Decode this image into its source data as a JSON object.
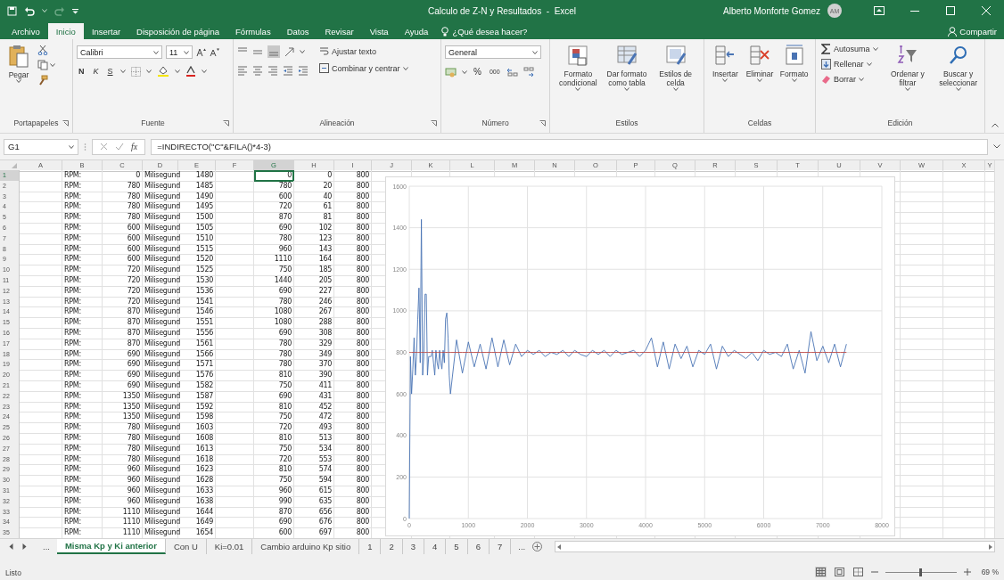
{
  "title_bar": {
    "title": "Calculo de Z-N y Resultados  -  Excel",
    "user": "Alberto Monforte Gomez",
    "initials": "AM"
  },
  "menu": {
    "tabs": [
      {
        "label": "Archivo",
        "selected": false
      },
      {
        "label": "Inicio",
        "selected": true
      },
      {
        "label": "Insertar",
        "selected": false
      },
      {
        "label": "Disposición de página",
        "selected": false
      },
      {
        "label": "Fórmulas",
        "selected": false
      },
      {
        "label": "Datos",
        "selected": false
      },
      {
        "label": "Revisar",
        "selected": false
      },
      {
        "label": "Vista",
        "selected": false
      },
      {
        "label": "Ayuda",
        "selected": false
      }
    ],
    "tell_me": "¿Qué desea hacer?",
    "share": "Compartir"
  },
  "ribbon": {
    "groups": [
      {
        "kind": "clipboard",
        "title": "Portapapeles",
        "paste": "Pegar"
      },
      {
        "kind": "font",
        "title": "Fuente",
        "font": "Calibri",
        "size": "11",
        "bold": "N",
        "italic": "K",
        "underline": "S"
      },
      {
        "kind": "alignment",
        "title": "Alineación",
        "wrap": "Ajustar texto",
        "merge": "Combinar y centrar"
      },
      {
        "kind": "number",
        "title": "Número",
        "format": "General",
        "percent": "%",
        "thousands": "000"
      },
      {
        "kind": "styles",
        "title": "Estilos",
        "buttons": [
          "Formato condicional",
          "Dar formato como tabla",
          "Estilos de celda"
        ]
      },
      {
        "kind": "cells",
        "title": "Celdas",
        "buttons": [
          "Insertar",
          "Eliminar",
          "Formato"
        ]
      },
      {
        "kind": "editing",
        "title": "Edición",
        "small": [
          "Autosuma",
          "Rellenar",
          "Borrar"
        ],
        "buttons": [
          "Ordenar y filtrar",
          "Buscar y seleccionar"
        ]
      }
    ]
  },
  "formula_bar": {
    "name_box": "G1",
    "fx": "fx",
    "formula": "=INDIRECTO(\"C\"&FILA()*4-3)"
  },
  "sheet": {
    "columns": [
      {
        "label": "A",
        "selected": false
      },
      {
        "label": "B",
        "selected": false
      },
      {
        "label": "C",
        "selected": false
      },
      {
        "label": "D",
        "selected": false
      },
      {
        "label": "E",
        "selected": false
      },
      {
        "label": "F",
        "selected": false
      },
      {
        "label": "G",
        "selected": true
      },
      {
        "label": "H",
        "selected": false
      },
      {
        "label": "I",
        "selected": false
      },
      {
        "label": "J",
        "selected": false
      },
      {
        "label": "K",
        "selected": false
      },
      {
        "label": "L",
        "selected": false
      },
      {
        "label": "M",
        "selected": false
      },
      {
        "label": "N",
        "selected": false
      },
      {
        "label": "O",
        "selected": false
      },
      {
        "label": "P",
        "selected": false
      },
      {
        "label": "Q",
        "selected": false
      },
      {
        "label": "R",
        "selected": false
      },
      {
        "label": "S",
        "selected": false
      },
      {
        "label": "T",
        "selected": false
      },
      {
        "label": "U",
        "selected": false
      },
      {
        "label": "V",
        "selected": false
      },
      {
        "label": "W",
        "selected": false
      },
      {
        "label": "X",
        "selected": false
      },
      {
        "label": "Y",
        "selected": false
      }
    ],
    "rows": [
      {
        "n": "1",
        "selected": true,
        "b": "RPM:",
        "c": "0",
        "d": "Milisegund",
        "e": "1480",
        "g": "0",
        "h": "0",
        "i": "800"
      },
      {
        "n": "2",
        "selected": false,
        "b": "RPM:",
        "c": "780",
        "d": "Milisegund",
        "e": "1485",
        "g": "780",
        "h": "20",
        "i": "800"
      },
      {
        "n": "3",
        "selected": false,
        "b": "RPM:",
        "c": "780",
        "d": "Milisegund",
        "e": "1490",
        "g": "600",
        "h": "40",
        "i": "800"
      },
      {
        "n": "4",
        "selected": false,
        "b": "RPM:",
        "c": "780",
        "d": "Milisegund",
        "e": "1495",
        "g": "720",
        "h": "61",
        "i": "800"
      },
      {
        "n": "5",
        "selected": false,
        "b": "RPM:",
        "c": "780",
        "d": "Milisegund",
        "e": "1500",
        "g": "870",
        "h": "81",
        "i": "800"
      },
      {
        "n": "6",
        "selected": false,
        "b": "RPM:",
        "c": "600",
        "d": "Milisegund",
        "e": "1505",
        "g": "690",
        "h": "102",
        "i": "800"
      },
      {
        "n": "7",
        "selected": false,
        "b": "RPM:",
        "c": "600",
        "d": "Milisegund",
        "e": "1510",
        "g": "780",
        "h": "123",
        "i": "800"
      },
      {
        "n": "8",
        "selected": false,
        "b": "RPM:",
        "c": "600",
        "d": "Milisegund",
        "e": "1515",
        "g": "960",
        "h": "143",
        "i": "800"
      },
      {
        "n": "9",
        "selected": false,
        "b": "RPM:",
        "c": "600",
        "d": "Milisegund",
        "e": "1520",
        "g": "1110",
        "h": "164",
        "i": "800"
      },
      {
        "n": "10",
        "selected": false,
        "b": "RPM:",
        "c": "720",
        "d": "Milisegund",
        "e": "1525",
        "g": "750",
        "h": "185",
        "i": "800"
      },
      {
        "n": "11",
        "selected": false,
        "b": "RPM:",
        "c": "720",
        "d": "Milisegund",
        "e": "1530",
        "g": "1440",
        "h": "205",
        "i": "800"
      },
      {
        "n": "12",
        "selected": false,
        "b": "RPM:",
        "c": "720",
        "d": "Milisegund",
        "e": "1536",
        "g": "690",
        "h": "227",
        "i": "800"
      },
      {
        "n": "13",
        "selected": false,
        "b": "RPM:",
        "c": "720",
        "d": "Milisegund",
        "e": "1541",
        "g": "780",
        "h": "246",
        "i": "800"
      },
      {
        "n": "14",
        "selected": false,
        "b": "RPM:",
        "c": "870",
        "d": "Milisegund",
        "e": "1546",
        "g": "1080",
        "h": "267",
        "i": "800"
      },
      {
        "n": "15",
        "selected": false,
        "b": "RPM:",
        "c": "870",
        "d": "Milisegund",
        "e": "1551",
        "g": "1080",
        "h": "288",
        "i": "800"
      },
      {
        "n": "16",
        "selected": false,
        "b": "RPM:",
        "c": "870",
        "d": "Milisegund",
        "e": "1556",
        "g": "690",
        "h": "308",
        "i": "800"
      },
      {
        "n": "17",
        "selected": false,
        "b": "RPM:",
        "c": "870",
        "d": "Milisegund",
        "e": "1561",
        "g": "780",
        "h": "329",
        "i": "800"
      },
      {
        "n": "18",
        "selected": false,
        "b": "RPM:",
        "c": "690",
        "d": "Milisegund",
        "e": "1566",
        "g": "780",
        "h": "349",
        "i": "800"
      },
      {
        "n": "19",
        "selected": false,
        "b": "RPM:",
        "c": "690",
        "d": "Milisegund",
        "e": "1571",
        "g": "780",
        "h": "370",
        "i": "800"
      },
      {
        "n": "20",
        "selected": false,
        "b": "RPM:",
        "c": "690",
        "d": "Milisegund",
        "e": "1576",
        "g": "810",
        "h": "390",
        "i": "800"
      },
      {
        "n": "21",
        "selected": false,
        "b": "RPM:",
        "c": "690",
        "d": "Milisegund",
        "e": "1582",
        "g": "750",
        "h": "411",
        "i": "800"
      },
      {
        "n": "22",
        "selected": false,
        "b": "RPM:",
        "c": "1350",
        "d": "Milisegund",
        "e": "1587",
        "g": "690",
        "h": "431",
        "i": "800"
      },
      {
        "n": "23",
        "selected": false,
        "b": "RPM:",
        "c": "1350",
        "d": "Milisegund",
        "e": "1592",
        "g": "810",
        "h": "452",
        "i": "800"
      },
      {
        "n": "24",
        "selected": false,
        "b": "RPM:",
        "c": "1350",
        "d": "Milisegund",
        "e": "1598",
        "g": "750",
        "h": "472",
        "i": "800"
      },
      {
        "n": "25",
        "selected": false,
        "b": "RPM:",
        "c": "780",
        "d": "Milisegund",
        "e": "1603",
        "g": "720",
        "h": "493",
        "i": "800"
      },
      {
        "n": "26",
        "selected": false,
        "b": "RPM:",
        "c": "780",
        "d": "Milisegund",
        "e": "1608",
        "g": "810",
        "h": "513",
        "i": "800"
      },
      {
        "n": "27",
        "selected": false,
        "b": "RPM:",
        "c": "780",
        "d": "Milisegund",
        "e": "1613",
        "g": "750",
        "h": "534",
        "i": "800"
      },
      {
        "n": "28",
        "selected": false,
        "b": "RPM:",
        "c": "780",
        "d": "Milisegund",
        "e": "1618",
        "g": "720",
        "h": "553",
        "i": "800"
      },
      {
        "n": "29",
        "selected": false,
        "b": "RPM:",
        "c": "960",
        "d": "Milisegund",
        "e": "1623",
        "g": "810",
        "h": "574",
        "i": "800"
      },
      {
        "n": "30",
        "selected": false,
        "b": "RPM:",
        "c": "960",
        "d": "Milisegund",
        "e": "1628",
        "g": "750",
        "h": "594",
        "i": "800"
      },
      {
        "n": "31",
        "selected": false,
        "b": "RPM:",
        "c": "960",
        "d": "Milisegund",
        "e": "1633",
        "g": "960",
        "h": "615",
        "i": "800"
      },
      {
        "n": "32",
        "selected": false,
        "b": "RPM:",
        "c": "960",
        "d": "Milisegund",
        "e": "1638",
        "g": "990",
        "h": "635",
        "i": "800"
      },
      {
        "n": "33",
        "selected": false,
        "b": "RPM:",
        "c": "1110",
        "d": "Milisegund",
        "e": "1644",
        "g": "870",
        "h": "656",
        "i": "800"
      },
      {
        "n": "34",
        "selected": false,
        "b": "RPM:",
        "c": "1110",
        "d": "Milisegund",
        "e": "1649",
        "g": "690",
        "h": "676",
        "i": "800"
      },
      {
        "n": "35",
        "selected": false,
        "b": "RPM:",
        "c": "1110",
        "d": "Milisegund",
        "e": "1654",
        "g": "600",
        "h": "697",
        "i": "800"
      }
    ],
    "chart_data": {
      "type": "line",
      "grid": true,
      "xlim": [
        0,
        8000
      ],
      "ylim": [
        0,
        1600
      ],
      "xticks": [
        0,
        1000,
        2000,
        3000,
        4000,
        5000,
        6000,
        7000,
        8000
      ],
      "yticks": [
        0,
        200,
        400,
        600,
        800,
        1000,
        1200,
        1400,
        1600
      ],
      "x": [
        0,
        20,
        40,
        61,
        81,
        102,
        123,
        143,
        164,
        185,
        205,
        227,
        246,
        267,
        288,
        308,
        329,
        349,
        370,
        390,
        411,
        431,
        452,
        472,
        493,
        513,
        534,
        553,
        574,
        594,
        615,
        635,
        656,
        676,
        697,
        800,
        900,
        1000,
        1100,
        1200,
        1300,
        1400,
        1500,
        1600,
        1700,
        1800,
        1900,
        2000,
        2100,
        2200,
        2300,
        2400,
        2500,
        2600,
        2700,
        2800,
        2900,
        3000,
        3100,
        3200,
        3300,
        3400,
        3500,
        3600,
        3700,
        3800,
        3900,
        4000,
        4100,
        4200,
        4300,
        4400,
        4500,
        4600,
        4700,
        4800,
        4900,
        5000,
        5100,
        5200,
        5300,
        5400,
        5500,
        5600,
        5700,
        5800,
        5900,
        6000,
        6100,
        6200,
        6300,
        6400,
        6500,
        6600,
        6700,
        6800,
        6900,
        7000,
        7100,
        7200,
        7300,
        7400
      ],
      "series": [
        {
          "color": "#4a74b4",
          "values": [
            0,
            780,
            600,
            720,
            870,
            690,
            780,
            960,
            1110,
            750,
            1440,
            690,
            780,
            1080,
            1080,
            690,
            780,
            780,
            780,
            810,
            750,
            690,
            810,
            750,
            720,
            810,
            750,
            720,
            810,
            750,
            960,
            990,
            870,
            690,
            600,
            860,
            700,
            850,
            730,
            840,
            720,
            870,
            730,
            860,
            740,
            840,
            780,
            810,
            790,
            810,
            780,
            800,
            790,
            810,
            780,
            810,
            790,
            780,
            810,
            790,
            810,
            780,
            810,
            790,
            800,
            810,
            780,
            810,
            870,
            730,
            850,
            720,
            840,
            770,
            830,
            730,
            810,
            790,
            840,
            720,
            830,
            780,
            810,
            790,
            770,
            800,
            760,
            810,
            790,
            800,
            780,
            840,
            720,
            810,
            700,
            900,
            760,
            830,
            750,
            840,
            730,
            840
          ]
        },
        {
          "color": "#c0504d",
          "values": [
            800,
            800,
            800,
            800,
            800,
            800,
            800,
            800,
            800,
            800,
            800,
            800,
            800,
            800,
            800,
            800,
            800,
            800,
            800,
            800,
            800,
            800,
            800,
            800,
            800,
            800,
            800,
            800,
            800,
            800,
            800,
            800,
            800,
            800,
            800,
            800,
            800,
            800,
            800,
            800,
            800,
            800,
            800,
            800,
            800,
            800,
            800,
            800,
            800,
            800,
            800,
            800,
            800,
            800,
            800,
            800,
            800,
            800,
            800,
            800,
            800,
            800,
            800,
            800,
            800,
            800,
            800,
            800,
            800,
            800,
            800,
            800,
            800,
            800,
            800,
            800,
            800,
            800,
            800,
            800,
            800,
            800,
            800,
            800,
            800,
            800,
            800,
            800,
            800,
            800,
            800,
            800,
            800,
            800,
            800,
            800,
            800,
            800,
            800,
            800,
            800,
            800
          ]
        }
      ]
    }
  },
  "sheet_tabs": {
    "overflow_left": "...",
    "tabs": [
      {
        "label": "Misma Kp y Ki anterior",
        "selected": true
      },
      {
        "label": "Con U",
        "selected": false
      },
      {
        "label": "Ki=0.01",
        "selected": false
      },
      {
        "label": "Cambio arduino Kp sitio",
        "selected": false
      },
      {
        "label": "1",
        "selected": false
      },
      {
        "label": "2",
        "selected": false
      },
      {
        "label": "3",
        "selected": false
      },
      {
        "label": "4",
        "selected": false
      },
      {
        "label": "5",
        "selected": false
      },
      {
        "label": "6",
        "selected": false
      },
      {
        "label": "7",
        "selected": false
      }
    ],
    "overflow_right": "..."
  },
  "status_bar": {
    "status": "Listo",
    "view_buttons": [
      {
        "kind": "normal",
        "selected": true
      },
      {
        "kind": "page_layout",
        "selected": false
      },
      {
        "kind": "page_break",
        "selected": false
      }
    ],
    "zoom_slider": {
      "level": 0.5
    },
    "zoom": "69 %"
  }
}
